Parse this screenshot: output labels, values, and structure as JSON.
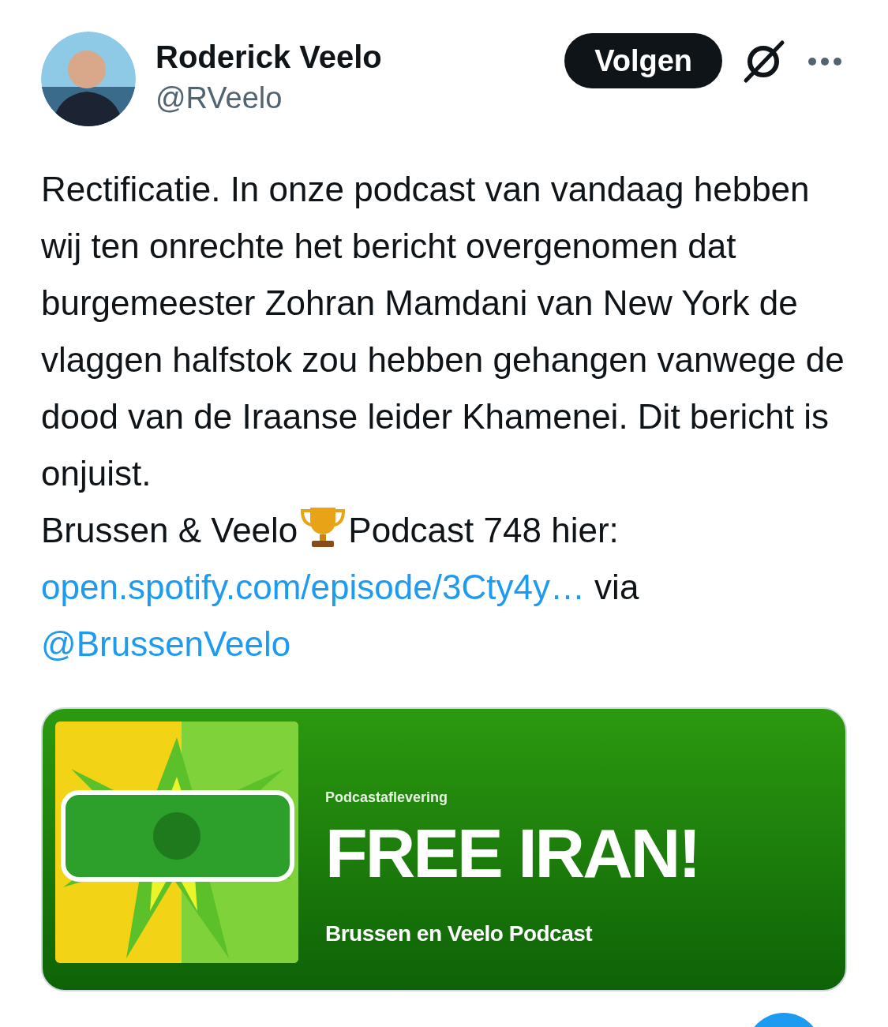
{
  "author": {
    "name": "Roderick Veelo",
    "handle": "@RVeelo"
  },
  "follow_button": {
    "label": "Volgen"
  },
  "tweet": {
    "text": "Rectificatie. In onze podcast van vandaag hebben wij ten onrechte het bericht overgenomen dat burgemeester Zohran Mamdani van New York de vlaggen halfstok zou hebben gehangen vanwege de dood van de Iraanse leider Khamenei. Dit bericht is onjuist.",
    "promo_before": "Brussen & Veelo",
    "promo_after": "Podcast 748 hier:",
    "link": "open.spotify.com/episode/3Cty4y…",
    "via": "via",
    "mention": "@BrussenVeelo"
  },
  "link_card": {
    "label": "Podcastaflevering",
    "title": "FREE IRAN!",
    "show": "Brussen en Veelo Podcast"
  }
}
